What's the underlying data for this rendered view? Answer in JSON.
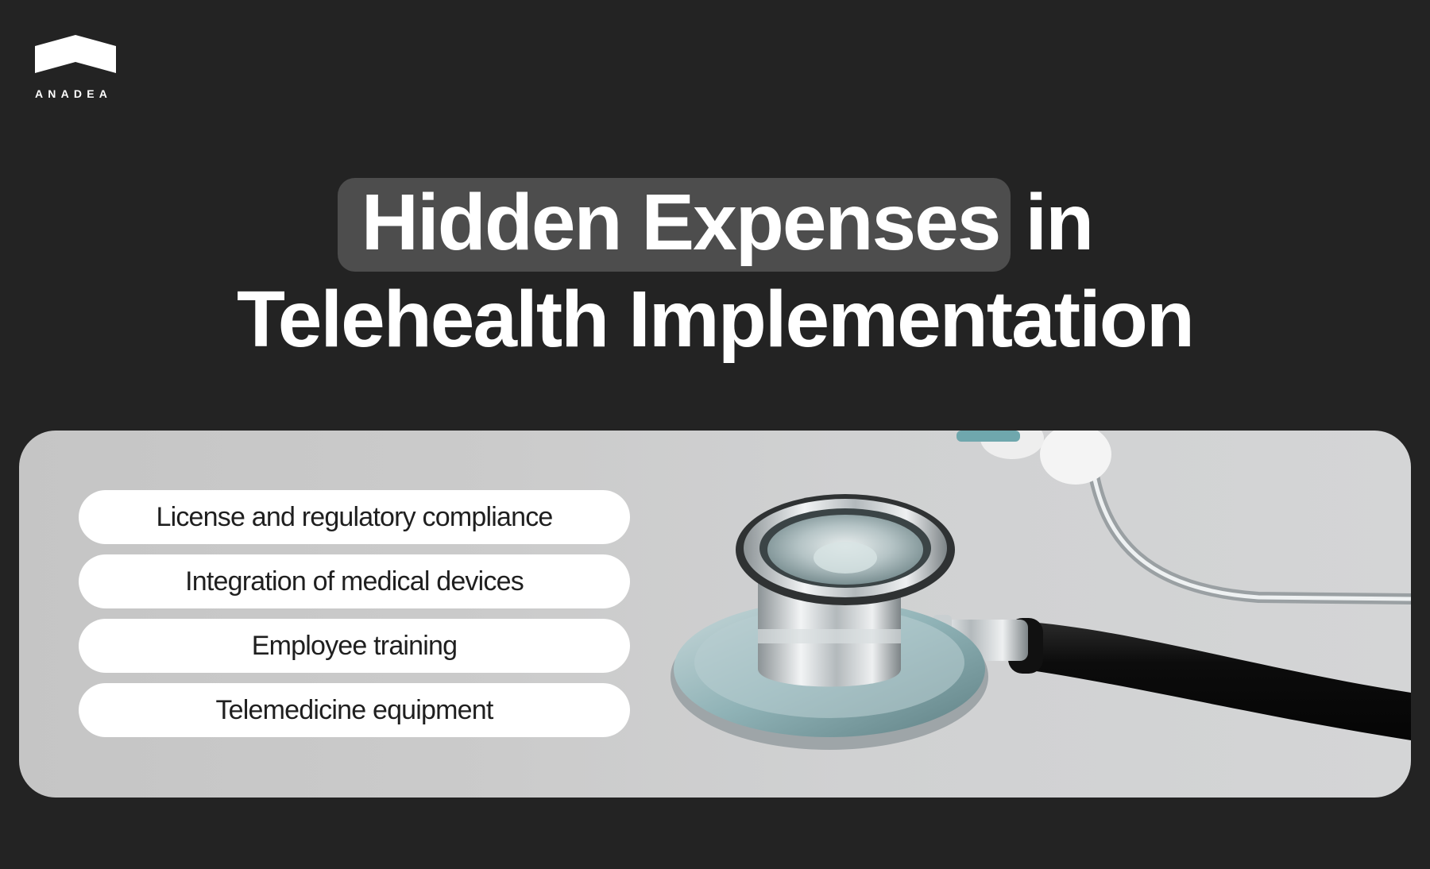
{
  "brand": {
    "name": "ANADEA",
    "logo_color": "#ffffff"
  },
  "headline": {
    "highlight": "Hidden Expenses",
    "rest_line1": "in",
    "line2": "Telehealth Implementation"
  },
  "expenses": [
    {
      "label": "License and regulatory compliance"
    },
    {
      "label": "Integration of medical devices"
    },
    {
      "label": "Employee training"
    },
    {
      "label": "Telemedicine equipment"
    }
  ],
  "colors": {
    "background": "#232323",
    "highlight": "#4d4d4d",
    "pill": "#ffffff",
    "text_dark": "#1f1f1f"
  }
}
